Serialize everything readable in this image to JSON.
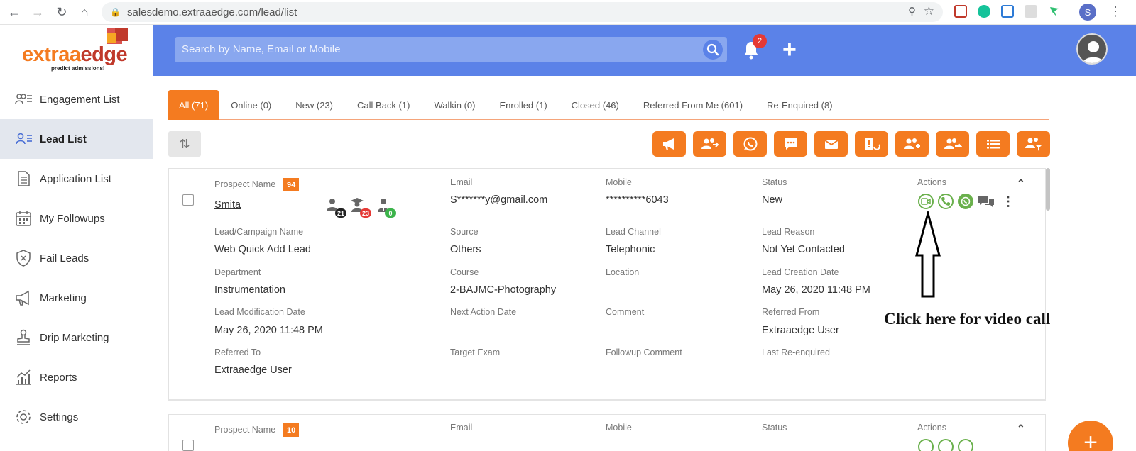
{
  "browser": {
    "url": "salesdemo.extraaedge.com/lead/list",
    "profile_initial": "S"
  },
  "logo": {
    "part1": "extraa",
    "part2": "edge",
    "tagline": "predict admissions!"
  },
  "header": {
    "search_placeholder": "Search by Name, Email or Mobile",
    "notification_count": "2",
    "add_label": "+"
  },
  "sidebar": {
    "items": [
      {
        "label": "Engagement List",
        "icon": "engagement-icon"
      },
      {
        "label": "Lead List",
        "icon": "lead-list-icon",
        "active": true
      },
      {
        "label": "Application List",
        "icon": "document-icon"
      },
      {
        "label": "My Followups",
        "icon": "calendar-icon"
      },
      {
        "label": "Fail Leads",
        "icon": "shield-x-icon"
      },
      {
        "label": "Marketing",
        "icon": "megaphone-icon"
      },
      {
        "label": "Drip Marketing",
        "icon": "stamp-icon"
      },
      {
        "label": "Reports",
        "icon": "chart-icon"
      },
      {
        "label": "Settings",
        "icon": "gear-icon"
      }
    ]
  },
  "tabs": [
    {
      "label": "All (71)",
      "active": true
    },
    {
      "label": "Online (0)"
    },
    {
      "label": "New (23)"
    },
    {
      "label": "Call Back (1)"
    },
    {
      "label": "Walkin (0)"
    },
    {
      "label": "Enrolled (1)"
    },
    {
      "label": "Closed (46)"
    },
    {
      "label": "Referred From Me (601)"
    },
    {
      "label": "Re-Enquired (8)"
    }
  ],
  "toolbar_actions": [
    "megaphone-icon",
    "transfer-users-icon",
    "whatsapp-icon",
    "sms-icon",
    "email-icon",
    "status-change-icon",
    "assign-users-icon",
    "move-users-icon",
    "list-icon",
    "filter-users-icon"
  ],
  "lead1": {
    "prospect_label": "Prospect Name",
    "score": "94",
    "name": "Smita",
    "badges": [
      "21",
      "23",
      "0"
    ],
    "email_label": "Email",
    "email": "S*******y@gmail.com",
    "mobile_label": "Mobile",
    "mobile": "**********6043",
    "status_label": "Status",
    "status": "New",
    "actions_label": "Actions",
    "fields": {
      "campaign_label": "Lead/Campaign Name",
      "campaign": "Web Quick Add Lead",
      "source_label": "Source",
      "source": "Others",
      "channel_label": "Lead Channel",
      "channel": "Telephonic",
      "reason_label": "Lead Reason",
      "reason": "Not Yet Contacted",
      "department_label": "Department",
      "department": "Instrumentation",
      "course_label": "Course",
      "course": "2-BAJMC-Photography",
      "location_label": "Location",
      "creation_label": "Lead Creation Date",
      "creation": "May 26, 2020 11:48 PM",
      "modification_label": "Lead Modification Date",
      "modification": "May 26, 2020 11:48 PM",
      "next_action_label": "Next Action Date",
      "comment_label": "Comment",
      "referred_from_label": "Referred From",
      "referred_from": "Extraaedge User",
      "referred_to_label": "Referred To",
      "referred_to": "Extraaedge User",
      "target_exam_label": "Target Exam",
      "followup_comment_label": "Followup Comment",
      "last_reenquired_label": "Last Re-enquired"
    }
  },
  "lead2": {
    "prospect_label": "Prospect Name",
    "score": "10",
    "email_label": "Email",
    "mobile_label": "Mobile",
    "status_label": "Status",
    "actions_label": "Actions"
  },
  "annotation": "Click here for video call",
  "colors": {
    "brand_orange": "#f47b20",
    "header_blue": "#5b82e8",
    "action_green": "#6ab04c"
  }
}
